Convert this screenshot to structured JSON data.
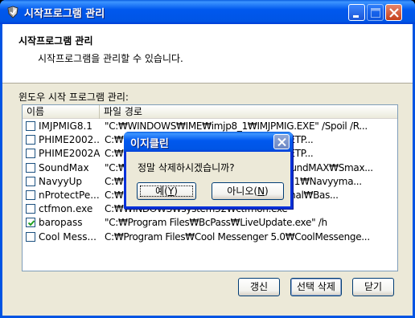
{
  "window": {
    "title": "시작프로그램 관리"
  },
  "header": {
    "title": "시작프로그램 관리",
    "description": "시작프로그램을 관리할 수 있습니다."
  },
  "list": {
    "label": "윈도우 시작 프로그램 관리:",
    "columns": [
      "이름",
      "파일 경로"
    ],
    "rows": [
      {
        "name": "IMJPMIG8.1",
        "path": "\"C:₩WINDOWS₩IME₩imjp8_1₩IMJPMIG.EXE\" /Spoil /R...",
        "checked": false
      },
      {
        "name": "PHIME2002...",
        "path": "C:₩WINDOWS₩IME₩TINTLGNT₩TINTSETP...",
        "checked": false
      },
      {
        "name": "PHIME2002A",
        "path": "C:₩WINDOWS₩IME₩TINTLGNT₩TINTSETP...",
        "checked": false
      },
      {
        "name": "SoundMax",
        "path": "\"C:₩Program Files₩Analog Devices₩SoundMAX₩Smax...",
        "checked": false
      },
      {
        "name": "NavyyUp",
        "path": "C:₩Program Files₩Navyy₩Navyyman 5.1₩Navyyma...",
        "checked": false
      },
      {
        "name": "nProtectPe...",
        "path": "C:₩Program Files₩INCA₩nProtectPersonal₩Bas...",
        "checked": false
      },
      {
        "name": "ctfmon.exe",
        "path": "C:₩WINDOWS₩system32₩ctfmon.exe",
        "checked": false
      },
      {
        "name": "baropass",
        "path": "\"C:₩Program Files₩BcPass₩LiveUpdate.exe\" /h",
        "checked": true
      },
      {
        "name": "Cool Mess...",
        "path": "C:₩Program Files₩Cool Messenger 5.0₩CoolMessenge...",
        "checked": false
      }
    ]
  },
  "buttons": {
    "refresh": "갱신",
    "delete_selected": "선택 삭제",
    "close": "닫기"
  },
  "dialog": {
    "title": "이지클린",
    "message": "정말 삭제하시겠습니까?",
    "yes_label": "예(",
    "yes_hotkey": "Y",
    "no_label": "아니오(",
    "no_hotkey": "N",
    "paren_close": ")"
  },
  "icons": {
    "app": "shield-icon",
    "minimize": "minimize-icon",
    "maximize": "maximize-icon",
    "close": "close-icon",
    "checkbox": "checkmark-icon"
  }
}
